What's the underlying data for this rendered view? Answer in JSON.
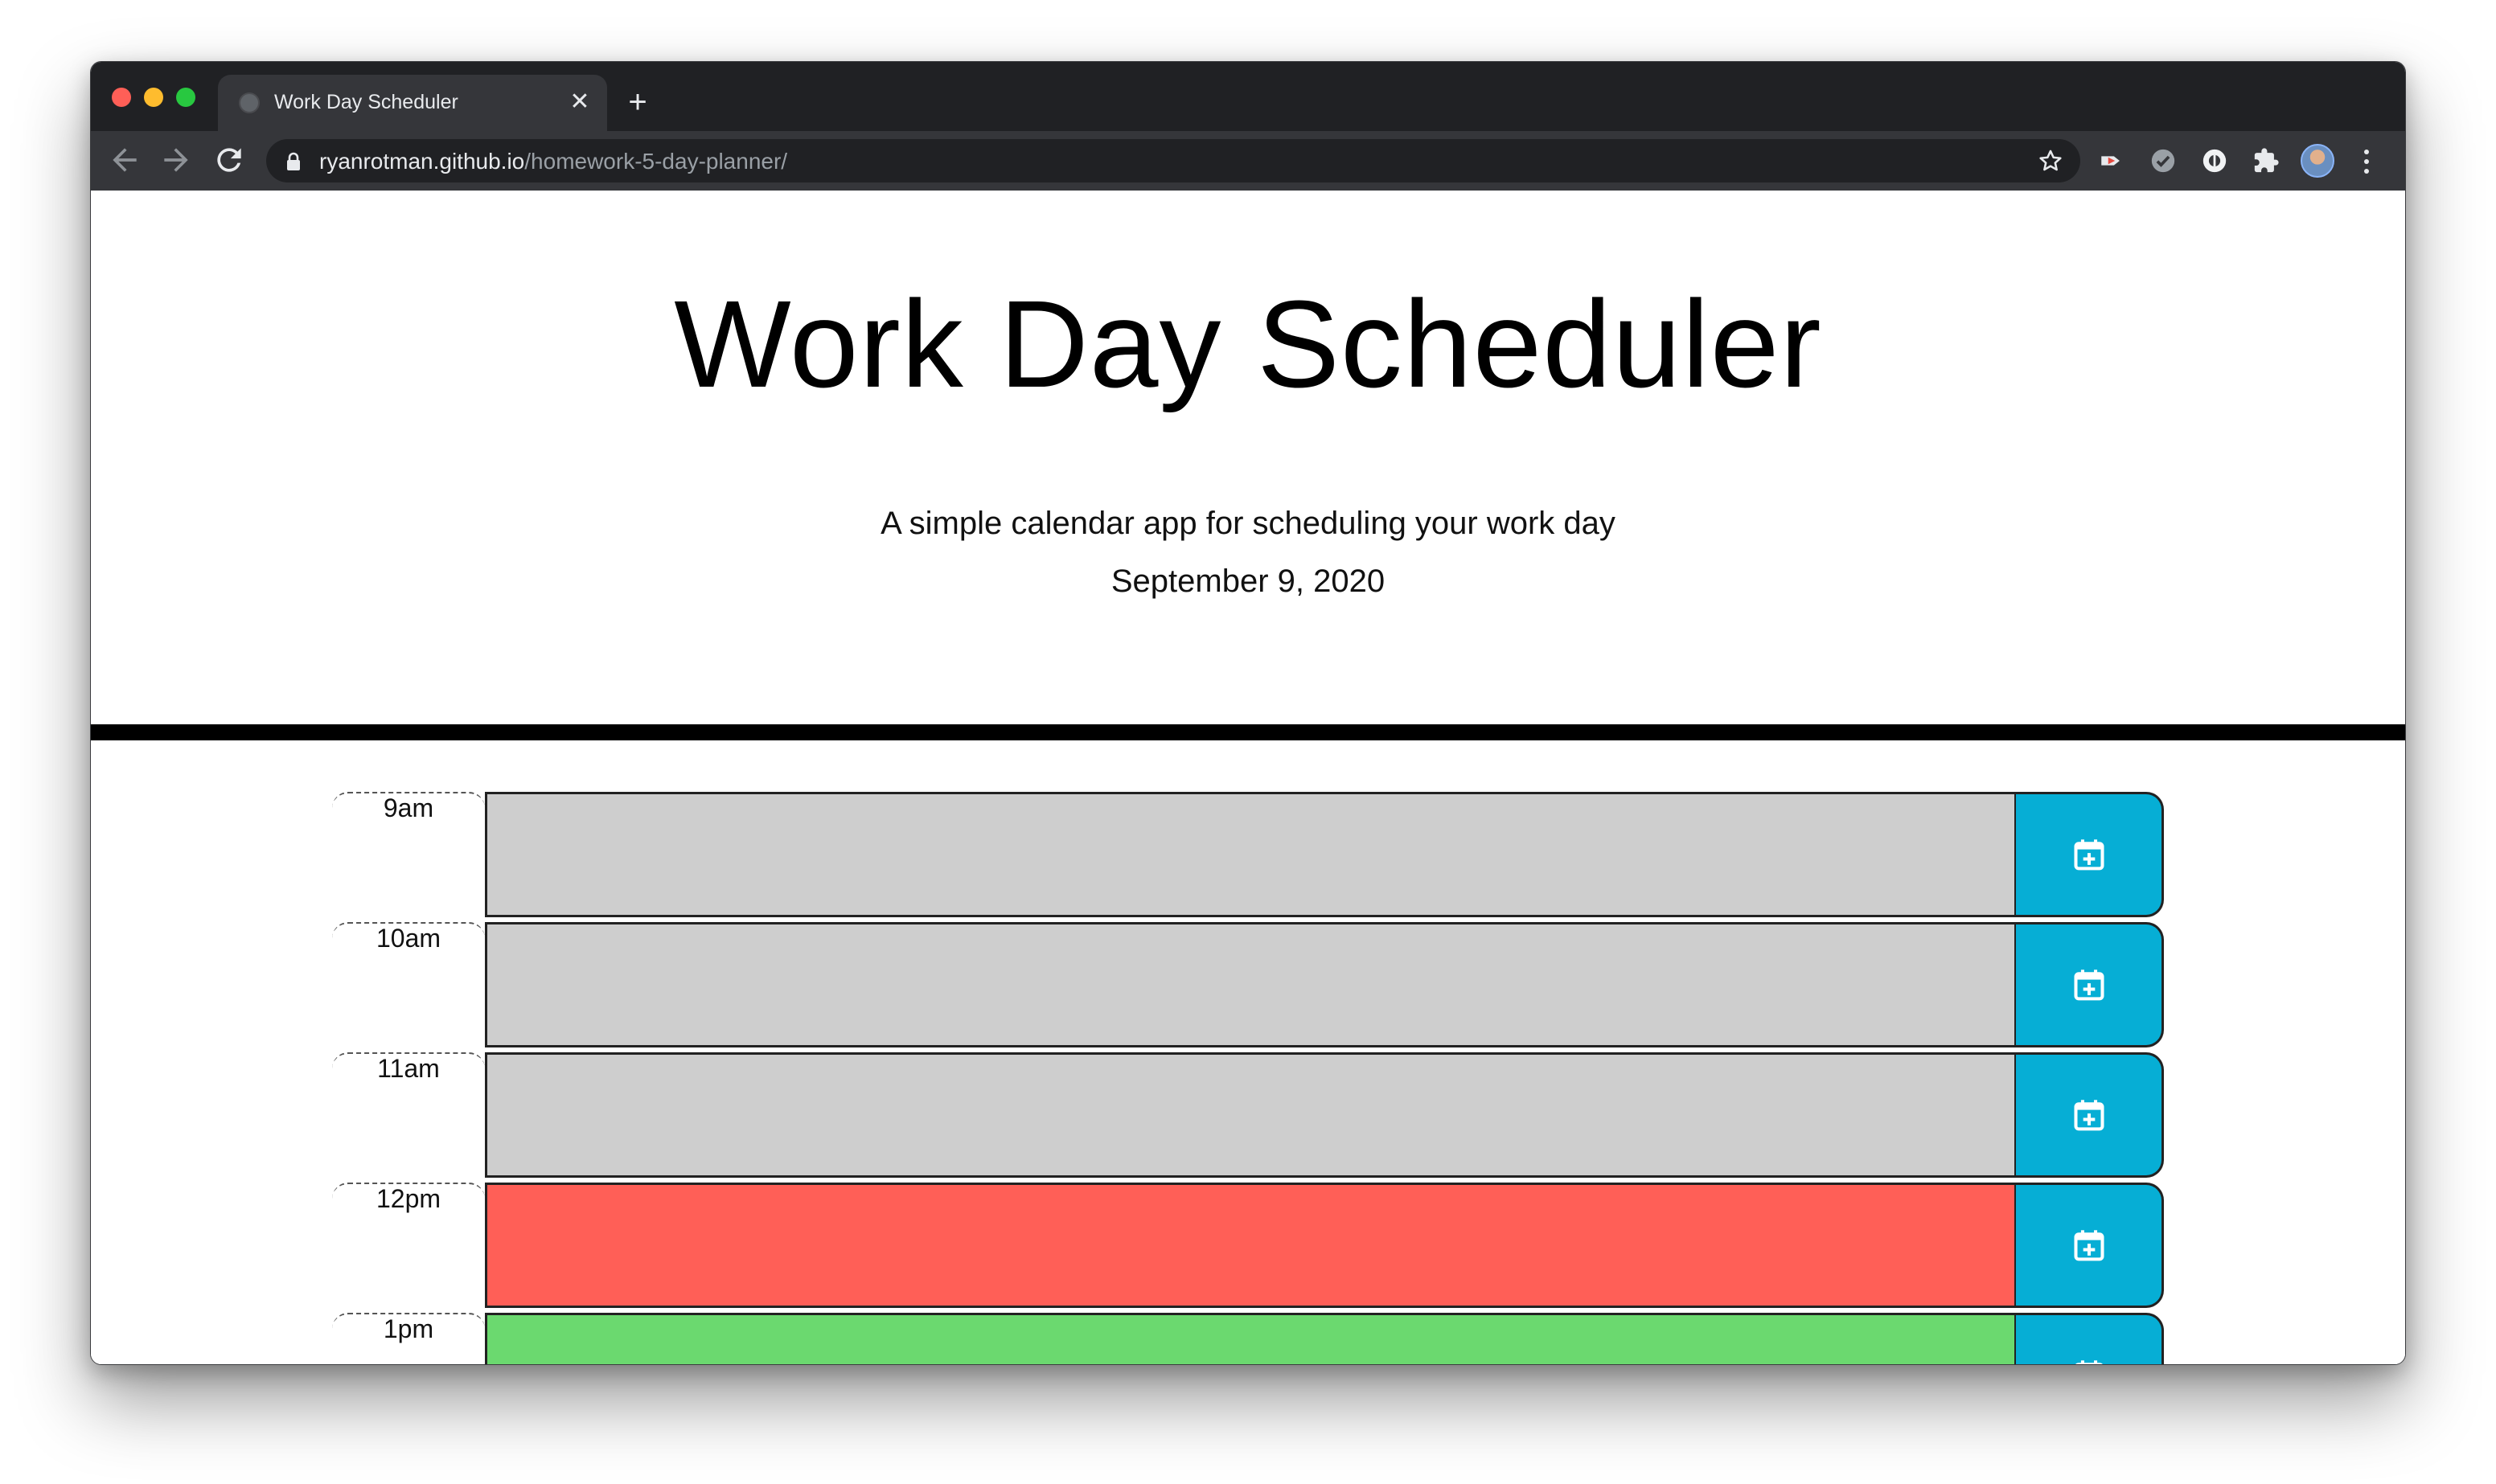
{
  "browser": {
    "tab_title": "Work Day Scheduler",
    "tab_close": "✕",
    "new_tab": "+",
    "url_host": "ryanrotman.github.io",
    "url_path": "/homework-5-day-planner/"
  },
  "header": {
    "title": "Work Day Scheduler",
    "lead": "A simple calendar app for scheduling your work day",
    "date": "September 9, 2020"
  },
  "colors": {
    "past": "#cecece",
    "present": "#ff5f57",
    "future": "#6bd96f",
    "save_button": "#06aed5"
  },
  "time_blocks": [
    {
      "hour": "9am",
      "state": "past",
      "text": ""
    },
    {
      "hour": "10am",
      "state": "past",
      "text": ""
    },
    {
      "hour": "11am",
      "state": "past",
      "text": ""
    },
    {
      "hour": "12pm",
      "state": "present",
      "text": ""
    },
    {
      "hour": "1pm",
      "state": "future",
      "text": ""
    }
  ],
  "icons": {
    "save": "calendar-plus-icon",
    "back": "arrow-left-icon",
    "forward": "arrow-right-icon",
    "reload": "reload-icon",
    "lock": "lock-icon",
    "bookmark": "star-icon",
    "extensions": "puzzle-icon",
    "menu": "kebab-menu-icon"
  }
}
